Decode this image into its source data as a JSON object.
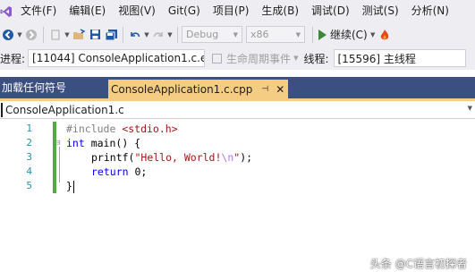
{
  "menu": {
    "items": [
      "文件(F)",
      "编辑(E)",
      "视图(V)",
      "Git(G)",
      "项目(P)",
      "生成(B)",
      "调试(D)",
      "测试(S)",
      "分析(N)"
    ]
  },
  "toolbar": {
    "config_label": "Debug",
    "platform_label": "x86",
    "run_label": "继续(C)"
  },
  "debug_location": {
    "process_label": "进程:",
    "process_value": "[11044] ConsoleApplication1.c.e",
    "lifecycle_label": "生命周期事件",
    "thread_label": "线程:",
    "thread_value": "[15596] 主线程"
  },
  "tabs": {
    "left_label": "加载任何符号",
    "active_title": "ConsoleApplication1.c.cpp",
    "pin_glyph": "⊣",
    "close_glyph": "✕"
  },
  "navbar": {
    "file": "ConsoleApplication1.c"
  },
  "editor": {
    "line_numbers": [
      "1",
      "2",
      "3",
      "4",
      "5"
    ],
    "line1": {
      "directive": "#include ",
      "header": "<stdio.h>"
    },
    "line2": {
      "keyword": "int",
      "rest": " main() {"
    },
    "line3": {
      "fn": "printf(",
      "str_a": "\"Hello, World!",
      "esc": "\\n",
      "str_b": "\"",
      "end": ");"
    },
    "line4": {
      "keyword": "return",
      "rest": " 0;"
    },
    "line5": {
      "brace": "}"
    }
  },
  "watermark": "头条 @C语言初探者",
  "colors": {
    "accent_tab": "#f5cc84",
    "tab_strip": "#3b4f81",
    "change_bar": "#57a64a",
    "keyword": "#0000ff",
    "string": "#a31515"
  }
}
